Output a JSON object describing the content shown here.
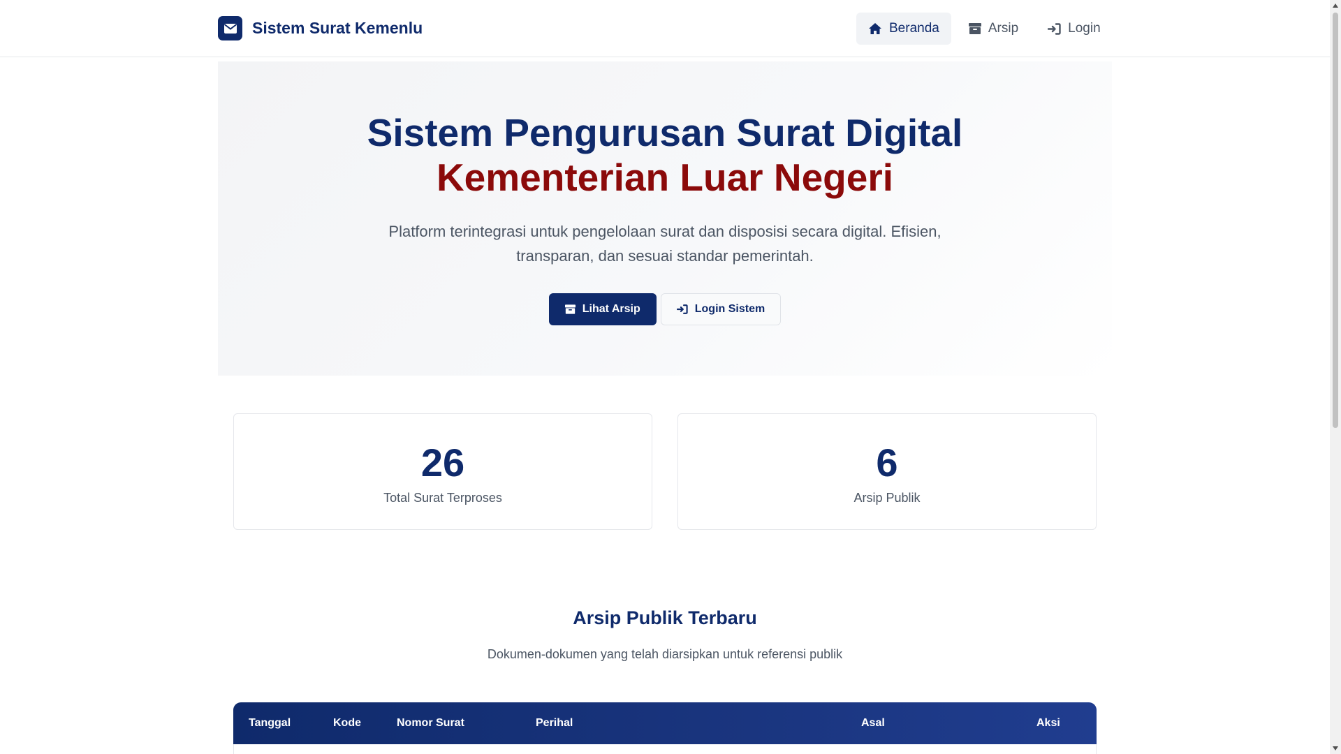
{
  "navbar": {
    "brand": "Sistem Surat Kemenlu",
    "items": [
      {
        "label": "Beranda",
        "icon": "home-icon",
        "active": true
      },
      {
        "label": "Arsip",
        "icon": "archive-icon",
        "active": false
      },
      {
        "label": "Login",
        "icon": "login-icon",
        "active": false
      }
    ]
  },
  "hero": {
    "title_line1": "Sistem Pengurusan Surat Digital",
    "title_line2": "Kementerian Luar Negeri",
    "subtitle": "Platform terintegrasi untuk pengelolaan surat dan disposisi secara digital. Efisien, transparan, dan sesuai standar pemerintah.",
    "primary_button": "Lihat Arsip",
    "secondary_button": "Login Sistem"
  },
  "stats": [
    {
      "value": "26",
      "label": "Total Surat Terproses"
    },
    {
      "value": "6",
      "label": "Arsip Publik"
    }
  ],
  "archive_section": {
    "title": "Arsip Publik Terbaru",
    "subtitle": "Dokumen-dokumen yang telah diarsipkan untuk referensi publik",
    "columns": [
      "Tanggal",
      "Kode",
      "Nomor Surat",
      "Perihal",
      "Asal",
      "Aksi"
    ]
  },
  "colors": {
    "primary": "#0f2a6b",
    "accent": "#8b0a0a"
  }
}
